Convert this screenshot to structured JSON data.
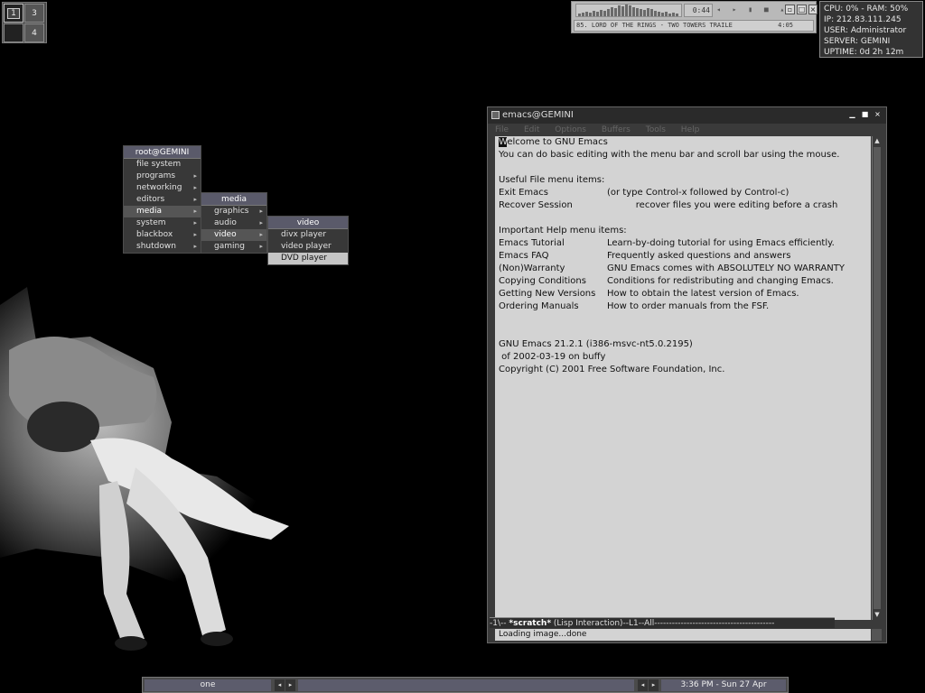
{
  "pager": {
    "workspaces": [
      "1",
      "3",
      "",
      "4"
    ]
  },
  "player": {
    "time": "0:44",
    "controls": "◂ ▸ ▮ ■ ▴",
    "track": "85. LORD OF THE RINGS - TWO TOWERS TRAILE",
    "length": "4:05",
    "viz_heights": [
      3,
      4,
      5,
      4,
      6,
      5,
      7,
      6,
      8,
      10,
      9,
      12,
      11,
      13,
      12,
      10,
      9,
      8,
      7,
      9,
      8,
      6,
      5,
      4,
      5,
      3,
      4,
      3
    ]
  },
  "sysinfo": {
    "line1": "CPU: 0% - RAM: 50%",
    "line2": "IP: 212.83.111.245",
    "line3": "USER: Administrator",
    "line4": "SERVER: GEMINI",
    "line5": "UPTIME: 0d 2h 12m"
  },
  "root_menu": {
    "title": "root@GEMINI",
    "items": [
      {
        "label": "file system",
        "arrow": ""
      },
      {
        "label": "programs",
        "arrow": "▸"
      },
      {
        "label": "networking",
        "arrow": "▸"
      },
      {
        "label": "editors",
        "arrow": "▸"
      },
      {
        "label": "media",
        "arrow": "▸"
      },
      {
        "label": "system",
        "arrow": "▸"
      },
      {
        "label": "blackbox",
        "arrow": "▸"
      },
      {
        "label": "shutdown",
        "arrow": "▸"
      }
    ]
  },
  "media_menu": {
    "title": "media",
    "items": [
      {
        "label": "graphics",
        "arrow": "▸"
      },
      {
        "label": "audio",
        "arrow": "▸"
      },
      {
        "label": "video",
        "arrow": "▸"
      },
      {
        "label": "gaming",
        "arrow": "▸"
      }
    ]
  },
  "video_menu": {
    "title": "video",
    "items": [
      "divx player",
      "video player",
      "DVD player"
    ]
  },
  "emacs": {
    "title": "emacs@GEMINI",
    "menus": [
      "File",
      "Edit",
      "Options",
      "Buffers",
      "Tools",
      "Help"
    ],
    "lines": [
      [
        "W",
        "elcome to GNU Emacs"
      ],
      [
        "You can do basic editing with the menu bar and scroll bar using the mouse.",
        ""
      ],
      [
        "",
        ""
      ],
      [
        "Useful File menu items:",
        ""
      ],
      [
        "Exit Emacs",
        "(or type Control-x followed by Control-c)"
      ],
      [
        "Recover Session",
        "          recover files you were editing before a crash"
      ],
      [
        "",
        ""
      ],
      [
        "Important Help menu items:",
        ""
      ],
      [
        "Emacs Tutorial",
        "Learn-by-doing tutorial for using Emacs efficiently."
      ],
      [
        "Emacs FAQ",
        "Frequently asked questions and answers"
      ],
      [
        "(Non)Warranty",
        "GNU Emacs comes with ABSOLUTELY NO WARRANTY"
      ],
      [
        "Copying Conditions",
        "Conditions for redistributing and changing Emacs."
      ],
      [
        "Getting New Versions",
        "How to obtain the latest version of Emacs."
      ],
      [
        "Ordering Manuals",
        "How to order manuals from the FSF."
      ],
      [
        "",
        ""
      ],
      [
        "",
        ""
      ],
      [
        "GNU Emacs 21.2.1 (i386-msvc-nt5.0.2195)",
        ""
      ],
      [
        " of 2002-03-19 on buffy",
        ""
      ],
      [
        "Copyright (C) 2001 Free Software Foundation, Inc.",
        ""
      ]
    ],
    "modeline_pre": "-1\\--  ",
    "modeline_buffer": "*scratch*",
    "modeline_post": "      (Lisp Interaction)--L1--All-----------------------------------------",
    "minibuffer": "Loading image...done"
  },
  "taskbar": {
    "workspace": "one",
    "clock": "3:36 PM - Sun 27 Apr"
  }
}
